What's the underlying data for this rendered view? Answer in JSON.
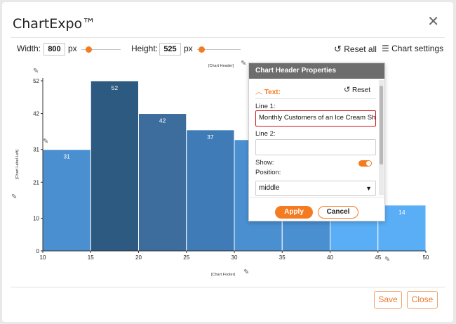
{
  "app": {
    "title": "ChartExpo™"
  },
  "toolbar": {
    "width_label": "Width:",
    "width_value": "800",
    "width_unit": "px",
    "height_label": "Height:",
    "height_value": "525",
    "height_unit": "px",
    "reset_all": "Reset all",
    "chart_settings": "Chart settings"
  },
  "chart": {
    "header_tag": "[Chart Header]",
    "footer_tag": "[Chart Footer]",
    "left_label_tag": "[Chart Label Left]"
  },
  "chart_data": {
    "type": "bar",
    "title": "",
    "xlabel": "",
    "ylabel": "",
    "x_ticks": [
      "10",
      "15",
      "20",
      "25",
      "30",
      "35",
      "40",
      "45",
      "50"
    ],
    "y_ticks": [
      "0",
      "10",
      "21",
      "31",
      "42",
      "52"
    ],
    "ylim": [
      0,
      52
    ],
    "bins": [
      {
        "x0": 10,
        "x1": 15,
        "value": 31,
        "color": "#4a8fd0"
      },
      {
        "x0": 15,
        "x1": 20,
        "value": 52,
        "color": "#2d5a80"
      },
      {
        "x0": 20,
        "x1": 25,
        "value": 42,
        "color": "#3d6d9c"
      },
      {
        "x0": 25,
        "x1": 30,
        "value": 37,
        "color": "#3e7bb7"
      },
      {
        "x0": 30,
        "x1": 35,
        "value": 34,
        "color": "#4a8fd0"
      },
      {
        "x0": 35,
        "x1": 40,
        "value": 14,
        "color": "#4a8fd0"
      },
      {
        "x0": 40,
        "x1": 45,
        "value": 14,
        "color": "#5aaef5"
      },
      {
        "x0": 45,
        "x1": 50,
        "value": 14,
        "color": "#5aaef5"
      }
    ],
    "visible_labels": {
      "0": "31",
      "1": "52",
      "2": "42",
      "3": "37",
      "7": "14"
    }
  },
  "panel": {
    "title": "Chart Header Properties",
    "section": "Text:",
    "reset": "Reset",
    "line1_label": "Line 1:",
    "line1_value": "Monthly Customers of an Ice Cream Shop",
    "line2_label": "Line 2:",
    "line2_value": "",
    "show_label": "Show:",
    "position_label": "Position:",
    "position_value": "middle",
    "apply": "Apply",
    "cancel": "Cancel"
  },
  "footer": {
    "save": "Save",
    "close": "Close"
  },
  "colors": {
    "accent": "#f47b20",
    "highlight_border": "#d0141a"
  }
}
